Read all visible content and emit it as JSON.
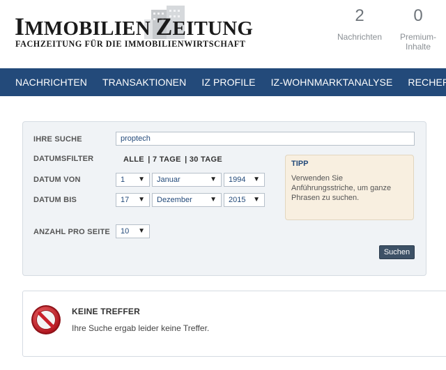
{
  "header": {
    "logo_title_parts": [
      "I",
      "MMOBILIEN ",
      "Z",
      "EITUNG"
    ],
    "logo_subtitle": "FACHZEITUNG FÜR DIE IMMOBILIENWIRTSCHAFT",
    "counters": [
      {
        "number": "2",
        "label": "Nachrichten"
      },
      {
        "number": "0",
        "label_line1": "Premium-",
        "label_line2": "Inhalte"
      }
    ]
  },
  "nav": {
    "items": [
      "NACHRICHTEN",
      "TRANSAKTIONEN",
      "IZ PROFILE",
      "IZ-WOHNMARKTANALYSE",
      "RECHERCHE"
    ]
  },
  "search": {
    "query_label": "IHRE SUCHE",
    "query_value": "proptech",
    "date_filter_label": "DATUMSFILTER",
    "quick_filters": [
      "ALLE",
      "| 7 TAGE",
      "| 30 TAGE"
    ],
    "date_from_label": "DATUM VON",
    "date_from": {
      "day": "1",
      "month": "Januar",
      "year": "1994"
    },
    "date_to_label": "DATUM BIS",
    "date_to": {
      "day": "17",
      "month": "Dezember",
      "year": "2015"
    },
    "per_page_label": "ANZAHL PRO SEITE",
    "per_page_value": "10",
    "submit_label": "Suchen",
    "tip": {
      "title": "TIPP",
      "text": "Verwenden Sie Anführungsstriche, um ganze Phrasen zu suchen."
    }
  },
  "result": {
    "title": "KEINE TREFFER",
    "message": "Ihre Suche ergab leider keine Treffer."
  },
  "colors": {
    "nav_bg": "#234a7a",
    "button_bg": "#3d5166",
    "tip_bg": "#f8efe0",
    "no_entry_red": "#c8202a"
  },
  "icons": {
    "dropdown": "▼",
    "result": "no-entry-icon",
    "logo": "building-icon"
  }
}
